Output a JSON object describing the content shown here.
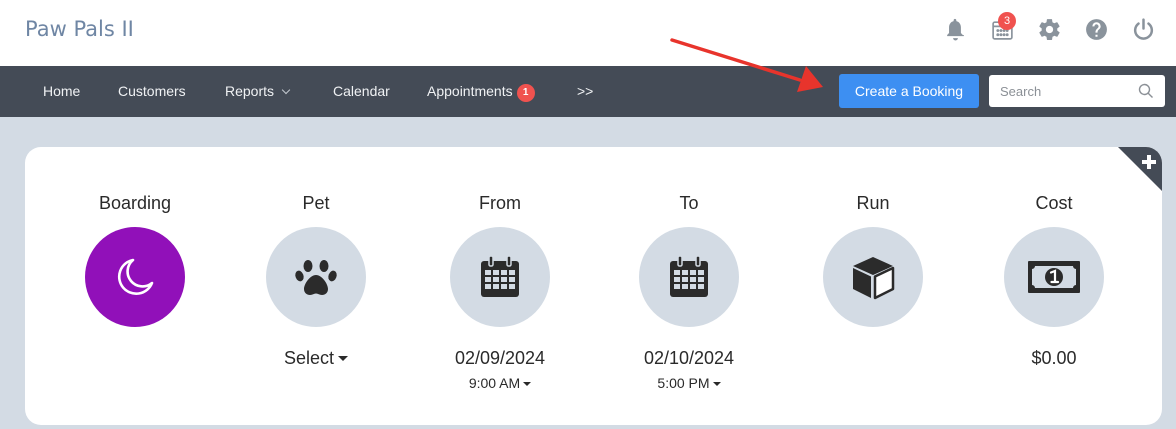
{
  "app": {
    "title": "Paw Pals II"
  },
  "top_icons": {
    "calendar_badge": "3"
  },
  "nav": {
    "items": [
      {
        "label": "Home"
      },
      {
        "label": "Customers"
      },
      {
        "label": "Reports"
      },
      {
        "label": "Calendar"
      },
      {
        "label": "Appointments",
        "badge": "1"
      },
      {
        "label": ">>"
      }
    ]
  },
  "actions": {
    "create_booking": "Create a Booking",
    "search_placeholder": "Search"
  },
  "booking": {
    "service": {
      "label": "Boarding"
    },
    "pet": {
      "label": "Pet",
      "value": "Select"
    },
    "from": {
      "label": "From",
      "date": "02/09/2024",
      "time": "9:00 AM"
    },
    "to": {
      "label": "To",
      "date": "02/10/2024",
      "time": "5:00 PM"
    },
    "run": {
      "label": "Run"
    },
    "cost": {
      "label": "Cost",
      "value": "$0.00"
    }
  },
  "colors": {
    "accent": "#3d8ff2",
    "service_active": "#9110b9",
    "navbar": "#444b56",
    "badge": "#f0524f",
    "annotation_arrow": "#e8342c"
  }
}
